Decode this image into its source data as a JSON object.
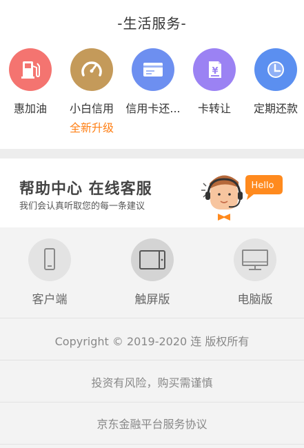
{
  "section": {
    "title": "-生活服务-"
  },
  "services": [
    {
      "label": "惠加油",
      "sub": "",
      "color": "#f47470",
      "icon": "fuel-pump-icon"
    },
    {
      "label": "小白信用",
      "sub": "全新升级",
      "color": "#c49a5a",
      "icon": "gauge-icon"
    },
    {
      "label": "信用卡还...",
      "sub": "",
      "color": "#6d8ff0",
      "icon": "credit-card-icon"
    },
    {
      "label": "卡转让",
      "sub": "",
      "color": "#9b82f3",
      "icon": "yen-card-icon"
    },
    {
      "label": "定期还款",
      "sub": "",
      "color": "#5b8ff0",
      "icon": "clock-icon"
    }
  ],
  "help": {
    "title": "帮助中心 在线客服",
    "subtitle": "我们会认真听取您的每一条建议",
    "bubble": "Hello",
    "bubble_color": "#ff8a1e"
  },
  "platforms": [
    {
      "label": "客户端",
      "icon": "phone-icon"
    },
    {
      "label": "触屏版",
      "icon": "tablet-icon"
    },
    {
      "label": "电脑版",
      "icon": "desktop-icon"
    }
  ],
  "footer": {
    "copyright": "Copyright © 2019-2020 连 版权所有",
    "risk": "投资有风险，购买需谨慎",
    "agreement": "京东金融平台服务协议"
  }
}
